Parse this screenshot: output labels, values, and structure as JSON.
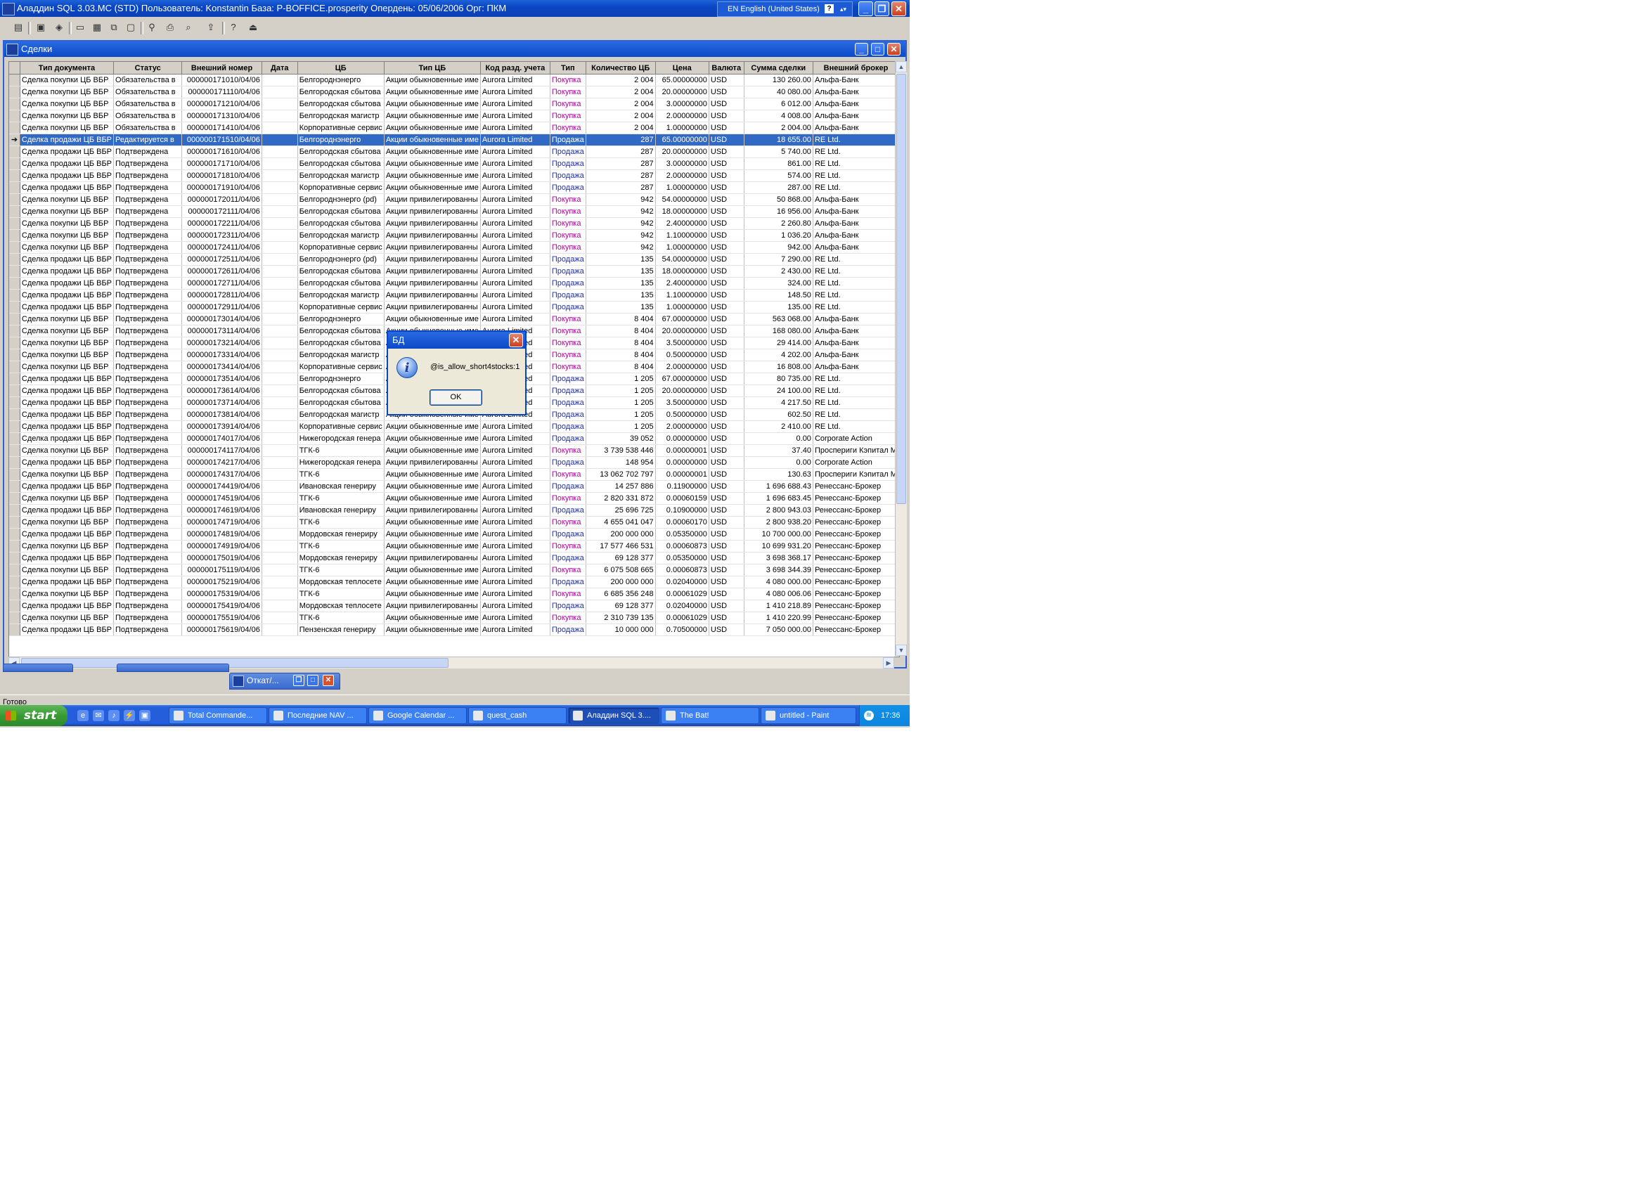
{
  "app": {
    "title": "Аладдин SQL 3.03.MC (STD)  Пользователь: Konstantin База: P-BOFFICE.prosperity Опердень: 05/06/2006 Орг: ПКМ",
    "lang": "EN English (United States)"
  },
  "toolbar": {
    "icons": [
      "new-document-icon",
      "open-icon",
      "view-icon",
      "window-icon",
      "tile-icon",
      "cascade-icon",
      "arrange-icon",
      "find-icon",
      "print-icon",
      "print-preview-icon",
      "export-icon",
      "help-icon",
      "exit-icon"
    ]
  },
  "mdi": {
    "title": "Сделки"
  },
  "grid": {
    "columns": [
      "Тип документа",
      "Статус",
      "Внешний номер",
      "Дата",
      "ЦБ",
      "Тип ЦБ",
      "Код разд. учета",
      "Тип",
      "Количество ЦБ",
      "Цена",
      "Валюта",
      "Сумма сделки",
      "Внешний брокер"
    ],
    "rows": [
      [
        "Сделка покупки ЦБ ВБР",
        "Обязательства в",
        "000000171010/04/06",
        "",
        "Белгороднэнерго",
        "Акции обыкновенные име",
        "Aurora Limited",
        "Покупка",
        "2 004",
        "65.00000000",
        "USD",
        "130 260.00",
        "Альфа-Банк"
      ],
      [
        "Сделка покупки ЦБ ВБР",
        "Обязательства в",
        "000000171110/04/06",
        "",
        "Белгородская сбытова",
        "Акции обыкновенные име",
        "Aurora Limited",
        "Покупка",
        "2 004",
        "20.00000000",
        "USD",
        "40 080.00",
        "Альфа-Банк"
      ],
      [
        "Сделка покупки ЦБ ВБР",
        "Обязательства в",
        "000000171210/04/06",
        "",
        "Белгородская сбытова",
        "Акции обыкновенные име",
        "Aurora Limited",
        "Покупка",
        "2 004",
        "3.00000000",
        "USD",
        "6 012.00",
        "Альфа-Банк"
      ],
      [
        "Сделка покупки ЦБ ВБР",
        "Обязательства в",
        "000000171310/04/06",
        "",
        "Белгородская магистр",
        "Акции обыкновенные име",
        "Aurora Limited",
        "Покупка",
        "2 004",
        "2.00000000",
        "USD",
        "4 008.00",
        "Альфа-Банк"
      ],
      [
        "Сделка покупки ЦБ ВБР",
        "Обязательства в",
        "000000171410/04/06",
        "",
        "Корпоративные сервис",
        "Акции обыкновенные име",
        "Aurora Limited",
        "Покупка",
        "2 004",
        "1.00000000",
        "USD",
        "2 004.00",
        "Альфа-Банк"
      ],
      [
        "Сделка продажи ЦБ ВБР",
        "Редактируется в",
        "000000171510/04/06",
        "",
        "Белгороднэнерго",
        "Акции обыкновенные име",
        "Aurora Limited",
        "Продажа",
        "287",
        "65.00000000",
        "USD",
        "18 655.00",
        "RE Ltd."
      ],
      [
        "Сделка продажи ЦБ ВБР",
        "Подтверждена",
        "000000171610/04/06",
        "",
        "Белгородская сбытова",
        "Акции обыкновенные име",
        "Aurora Limited",
        "Продажа",
        "287",
        "20.00000000",
        "USD",
        "5 740.00",
        "RE Ltd."
      ],
      [
        "Сделка продажи ЦБ ВБР",
        "Подтверждена",
        "000000171710/04/06",
        "",
        "Белгородская сбытова",
        "Акции обыкновенные име",
        "Aurora Limited",
        "Продажа",
        "287",
        "3.00000000",
        "USD",
        "861.00",
        "RE Ltd."
      ],
      [
        "Сделка продажи ЦБ ВБР",
        "Подтверждена",
        "000000171810/04/06",
        "",
        "Белгородская магистр",
        "Акции обыкновенные име",
        "Aurora Limited",
        "Продажа",
        "287",
        "2.00000000",
        "USD",
        "574.00",
        "RE Ltd."
      ],
      [
        "Сделка продажи ЦБ ВБР",
        "Подтверждена",
        "000000171910/04/06",
        "",
        "Корпоративные сервис",
        "Акции обыкновенные име",
        "Aurora Limited",
        "Продажа",
        "287",
        "1.00000000",
        "USD",
        "287.00",
        "RE Ltd."
      ],
      [
        "Сделка покупки ЦБ ВБР",
        "Подтверждена",
        "000000172011/04/06",
        "",
        "Белгороднэнерго (pd)",
        "Акции привилегированны",
        "Aurora Limited",
        "Покупка",
        "942",
        "54.00000000",
        "USD",
        "50 868.00",
        "Альфа-Банк"
      ],
      [
        "Сделка покупки ЦБ ВБР",
        "Подтверждена",
        "000000172111/04/06",
        "",
        "Белгородская сбытова",
        "Акции привилегированны",
        "Aurora Limited",
        "Покупка",
        "942",
        "18.00000000",
        "USD",
        "16 956.00",
        "Альфа-Банк"
      ],
      [
        "Сделка покупки ЦБ ВБР",
        "Подтверждена",
        "000000172211/04/06",
        "",
        "Белгородская сбытова",
        "Акции привилегированны",
        "Aurora Limited",
        "Покупка",
        "942",
        "2.40000000",
        "USD",
        "2 260.80",
        "Альфа-Банк"
      ],
      [
        "Сделка покупки ЦБ ВБР",
        "Подтверждена",
        "000000172311/04/06",
        "",
        "Белгородская магистр",
        "Акции привилегированны",
        "Aurora Limited",
        "Покупка",
        "942",
        "1.10000000",
        "USD",
        "1 036.20",
        "Альфа-Банк"
      ],
      [
        "Сделка покупки ЦБ ВБР",
        "Подтверждена",
        "000000172411/04/06",
        "",
        "Корпоративные сервис",
        "Акции привилегированны",
        "Aurora Limited",
        "Покупка",
        "942",
        "1.00000000",
        "USD",
        "942.00",
        "Альфа-Банк"
      ],
      [
        "Сделка продажи ЦБ ВБР",
        "Подтверждена",
        "000000172511/04/06",
        "",
        "Белгороднэнерго (pd)",
        "Акции привилегированны",
        "Aurora Limited",
        "Продажа",
        "135",
        "54.00000000",
        "USD",
        "7 290.00",
        "RE Ltd."
      ],
      [
        "Сделка продажи ЦБ ВБР",
        "Подтверждена",
        "000000172611/04/06",
        "",
        "Белгородская сбытова",
        "Акции привилегированны",
        "Aurora Limited",
        "Продажа",
        "135",
        "18.00000000",
        "USD",
        "2 430.00",
        "RE Ltd."
      ],
      [
        "Сделка продажи ЦБ ВБР",
        "Подтверждена",
        "000000172711/04/06",
        "",
        "Белгородская сбытова",
        "Акции привилегированны",
        "Aurora Limited",
        "Продажа",
        "135",
        "2.40000000",
        "USD",
        "324.00",
        "RE Ltd."
      ],
      [
        "Сделка продажи ЦБ ВБР",
        "Подтверждена",
        "000000172811/04/06",
        "",
        "Белгородская магистр",
        "Акции привилегированны",
        "Aurora Limited",
        "Продажа",
        "135",
        "1.10000000",
        "USD",
        "148.50",
        "RE Ltd."
      ],
      [
        "Сделка продажи ЦБ ВБР",
        "Подтверждена",
        "000000172911/04/06",
        "",
        "Корпоративные сервис",
        "Акции привилегированны",
        "Aurora Limited",
        "Продажа",
        "135",
        "1.00000000",
        "USD",
        "135.00",
        "RE Ltd."
      ],
      [
        "Сделка покупки ЦБ ВБР",
        "Подтверждена",
        "000000173014/04/06",
        "",
        "Белгороднэнерго",
        "Акции обыкновенные име",
        "Aurora Limited",
        "Покупка",
        "8 404",
        "67.00000000",
        "USD",
        "563 068.00",
        "Альфа-Банк"
      ],
      [
        "Сделка покупки ЦБ ВБР",
        "Подтверждена",
        "000000173114/04/06",
        "",
        "Белгородская сбытова",
        "Акции обыкновенные име",
        "Aurora Limited",
        "Покупка",
        "8 404",
        "20.00000000",
        "USD",
        "168 080.00",
        "Альфа-Банк"
      ],
      [
        "Сделка покупки ЦБ ВБР",
        "Подтверждена",
        "000000173214/04/06",
        "",
        "Белгородская сбытова",
        "Акции обыкновенные име",
        "Aurora Limited",
        "Покупка",
        "8 404",
        "3.50000000",
        "USD",
        "29 414.00",
        "Альфа-Банк"
      ],
      [
        "Сделка покупки ЦБ ВБР",
        "Подтверждена",
        "000000173314/04/06",
        "",
        "Белгородская магистр",
        "Акции обыкновенные име",
        "Aurora Limited",
        "Покупка",
        "8 404",
        "0.50000000",
        "USD",
        "4 202.00",
        "Альфа-Банк"
      ],
      [
        "Сделка покупки ЦБ ВБР",
        "Подтверждена",
        "000000173414/04/06",
        "",
        "Корпоративные сервис",
        "Акции обыкновенные име",
        "Aurora Limited",
        "Покупка",
        "8 404",
        "2.00000000",
        "USD",
        "16 808.00",
        "Альфа-Банк"
      ],
      [
        "Сделка продажи ЦБ ВБР",
        "Подтверждена",
        "000000173514/04/06",
        "",
        "Белгороднэнерго",
        "Акции обыкновенные име",
        "Aurora Limited",
        "Продажа",
        "1 205",
        "67.00000000",
        "USD",
        "80 735.00",
        "RE Ltd."
      ],
      [
        "Сделка продажи ЦБ ВБР",
        "Подтверждена",
        "000000173614/04/06",
        "",
        "Белгородская сбытова",
        "Акции обыкновенные име",
        "Aurora Limited",
        "Продажа",
        "1 205",
        "20.00000000",
        "USD",
        "24 100.00",
        "RE Ltd."
      ],
      [
        "Сделка продажи ЦБ ВБР",
        "Подтверждена",
        "000000173714/04/06",
        "",
        "Белгородская сбытова",
        "Акции обыкновенные име",
        "Aurora Limited",
        "Продажа",
        "1 205",
        "3.50000000",
        "USD",
        "4 217.50",
        "RE Ltd."
      ],
      [
        "Сделка продажи ЦБ ВБР",
        "Подтверждена",
        "000000173814/04/06",
        "",
        "Белгородская магистр",
        "Акции обыкновенные име",
        "Aurora Limited",
        "Продажа",
        "1 205",
        "0.50000000",
        "USD",
        "602.50",
        "RE Ltd."
      ],
      [
        "Сделка продажи ЦБ ВБР",
        "Подтверждена",
        "000000173914/04/06",
        "",
        "Корпоративные сервис",
        "Акции обыкновенные име",
        "Aurora Limited",
        "Продажа",
        "1 205",
        "2.00000000",
        "USD",
        "2 410.00",
        "RE Ltd."
      ],
      [
        "Сделка продажи ЦБ ВБР",
        "Подтверждена",
        "000000174017/04/06",
        "",
        "Нижегородская генера",
        "Акции обыкновенные име",
        "Aurora Limited",
        "Продажа",
        "39 052",
        "0.00000000",
        "USD",
        "0.00",
        "Corporate Action"
      ],
      [
        "Сделка покупки ЦБ ВБР",
        "Подтверждена",
        "000000174117/04/06",
        "",
        "ТГК-6",
        "Акции обыкновенные име",
        "Aurora Limited",
        "Покупка",
        "3 739 538 446",
        "0.00000001",
        "USD",
        "37.40",
        "Проспериги Кэпитал М"
      ],
      [
        "Сделка продажи ЦБ ВБР",
        "Подтверждена",
        "000000174217/04/06",
        "",
        "Нижегородская генера",
        "Акции привилегированны",
        "Aurora Limited",
        "Продажа",
        "148 954",
        "0.00000000",
        "USD",
        "0.00",
        "Corporate Action"
      ],
      [
        "Сделка покупки ЦБ ВБР",
        "Подтверждена",
        "000000174317/04/06",
        "",
        "ТГК-6",
        "Акции обыкновенные име",
        "Aurora Limited",
        "Покупка",
        "13 062 702 797",
        "0.00000001",
        "USD",
        "130.63",
        "Проспериги Кэпитал М"
      ],
      [
        "Сделка продажи ЦБ ВБР",
        "Подтверждена",
        "000000174419/04/06",
        "",
        "Ивановская генериру",
        "Акции обыкновенные име",
        "Aurora Limited",
        "Продажа",
        "14 257 886",
        "0.11900000",
        "USD",
        "1 696 688.43",
        "Ренессанс-Брокер"
      ],
      [
        "Сделка покупки ЦБ ВБР",
        "Подтверждена",
        "000000174519/04/06",
        "",
        "ТГК-6",
        "Акции обыкновенные име",
        "Aurora Limited",
        "Покупка",
        "2 820 331 872",
        "0.00060159",
        "USD",
        "1 696 683.45",
        "Ренессанс-Брокер"
      ],
      [
        "Сделка продажи ЦБ ВБР",
        "Подтверждена",
        "000000174619/04/06",
        "",
        "Ивановская генериру",
        "Акции привилегированны",
        "Aurora Limited",
        "Продажа",
        "25 696 725",
        "0.10900000",
        "USD",
        "2 800 943.03",
        "Ренессанс-Брокер"
      ],
      [
        "Сделка покупки ЦБ ВБР",
        "Подтверждена",
        "000000174719/04/06",
        "",
        "ТГК-6",
        "Акции обыкновенные име",
        "Aurora Limited",
        "Покупка",
        "4 655 041 047",
        "0.00060170",
        "USD",
        "2 800 938.20",
        "Ренессанс-Брокер"
      ],
      [
        "Сделка продажи ЦБ ВБР",
        "Подтверждена",
        "000000174819/04/06",
        "",
        "Мордовская генериру",
        "Акции обыкновенные име",
        "Aurora Limited",
        "Продажа",
        "200 000 000",
        "0.05350000",
        "USD",
        "10 700 000.00",
        "Ренессанс-Брокер"
      ],
      [
        "Сделка покупки ЦБ ВБР",
        "Подтверждена",
        "000000174919/04/06",
        "",
        "ТГК-6",
        "Акции обыкновенные име",
        "Aurora Limited",
        "Покупка",
        "17 577 466 531",
        "0.00060873",
        "USD",
        "10 699 931.20",
        "Ренессанс-Брокер"
      ],
      [
        "Сделка продажи ЦБ ВБР",
        "Подтверждена",
        "000000175019/04/06",
        "",
        "Мордовская генериру",
        "Акции привилегированны",
        "Aurora Limited",
        "Продажа",
        "69 128 377",
        "0.05350000",
        "USD",
        "3 698 368.17",
        "Ренессанс-Брокер"
      ],
      [
        "Сделка покупки ЦБ ВБР",
        "Подтверждена",
        "000000175119/04/06",
        "",
        "ТГК-6",
        "Акции обыкновенные име",
        "Aurora Limited",
        "Покупка",
        "6 075 508 665",
        "0.00060873",
        "USD",
        "3 698 344.39",
        "Ренессанс-Брокер"
      ],
      [
        "Сделка продажи ЦБ ВБР",
        "Подтверждена",
        "000000175219/04/06",
        "",
        "Мордовская теплосете",
        "Акции обыкновенные име",
        "Aurora Limited",
        "Продажа",
        "200 000 000",
        "0.02040000",
        "USD",
        "4 080 000.00",
        "Ренессанс-Брокер"
      ],
      [
        "Сделка покупки ЦБ ВБР",
        "Подтверждена",
        "000000175319/04/06",
        "",
        "ТГК-6",
        "Акции обыкновенные име",
        "Aurora Limited",
        "Покупка",
        "6 685 356 248",
        "0.00061029",
        "USD",
        "4 080 006.06",
        "Ренессанс-Брокер"
      ],
      [
        "Сделка продажи ЦБ ВБР",
        "Подтверждена",
        "000000175419/04/06",
        "",
        "Мордовская теплосете",
        "Акции привилегированны",
        "Aurora Limited",
        "Продажа",
        "69 128 377",
        "0.02040000",
        "USD",
        "1 410 218.89",
        "Ренессанс-Брокер"
      ],
      [
        "Сделка покупки ЦБ ВБР",
        "Подтверждена",
        "000000175519/04/06",
        "",
        "ТГК-6",
        "Акции обыкновенные име",
        "Aurora Limited",
        "Покупка",
        "2 310 739 135",
        "0.00061029",
        "USD",
        "1 410 220.99",
        "Ренессанс-Брокер"
      ],
      [
        "Сделка продажи ЦБ ВБР",
        "Подтверждена",
        "000000175619/04/06",
        "",
        "Пензенская генериру",
        "Акции обыкновенные име",
        "Aurora Limited",
        "Продажа",
        "10 000 000",
        "0.70500000",
        "USD",
        "7 050 000.00",
        "Ренессанс-Брокер"
      ]
    ]
  },
  "minimized": {
    "otkat": "Откат/..."
  },
  "status": {
    "text": "Готово"
  },
  "dialog": {
    "title": "БД",
    "message": "@is_allow_short4stocks:1",
    "ok": "OK"
  },
  "taskbar": {
    "start": "start",
    "tasks": [
      "Total Commande...",
      "Последние NAV ...",
      "Google Calendar ...",
      "quest_cash",
      "Аладдин SQL 3....",
      "The Bat!",
      "untitled - Paint"
    ],
    "clock": "17:36"
  }
}
